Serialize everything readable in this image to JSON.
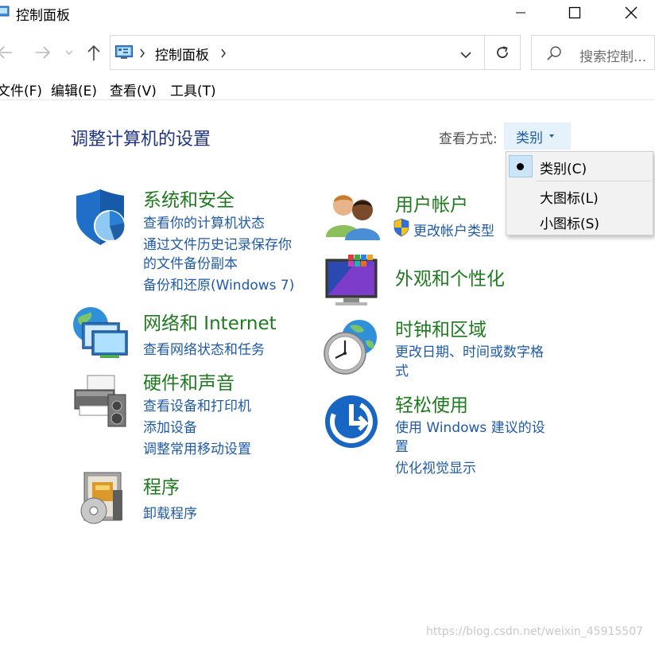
{
  "window": {
    "title": "控制面板"
  },
  "nav": {
    "address_text": "控制面板",
    "search_placeholder": "搜索控制..."
  },
  "menu": [
    "文件(F)",
    "编辑(E)",
    "查看(V)",
    "工具(T)"
  ],
  "page": {
    "title": "调整计算机的设置",
    "view_label": "查看方式:",
    "view_value": "类别"
  },
  "categories": {
    "system": {
      "title": "系统和安全",
      "links": [
        "查看你的计算机状态",
        "通过文件历史记录保存你",
        "的文件备份副本",
        "备份和还原(Windows 7)"
      ]
    },
    "network": {
      "title": "网络和 Internet",
      "links": [
        "查看网络状态和任务"
      ]
    },
    "hardware": {
      "title": "硬件和声音",
      "links": [
        "查看设备和打印机",
        "添加设备",
        "调整常用移动设置"
      ]
    },
    "programs": {
      "title": "程序",
      "links": [
        "卸载程序"
      ]
    },
    "users": {
      "title": "用户帐户",
      "links": [
        "更改帐户类型"
      ]
    },
    "appearance": {
      "title": "外观和个性化"
    },
    "clock": {
      "title": "时钟和区域",
      "links": [
        "更改日期、时间或数字格",
        "式"
      ]
    },
    "ease": {
      "title": "轻松使用",
      "links": [
        "使用 Windows 建议的设",
        "置",
        "优化视觉显示"
      ]
    }
  },
  "dropdown": {
    "items": [
      "类别(C)",
      "大图标(L)",
      "小图标(S)"
    ],
    "selected_index": 0
  },
  "watermark": "https://blog.csdn.net/weixin_45915507",
  "colors": {
    "category_title": "#1e7a1e",
    "link": "#1e5aa8",
    "page_title": "#1e3287",
    "dropdown_selected": "#cce4f7"
  }
}
